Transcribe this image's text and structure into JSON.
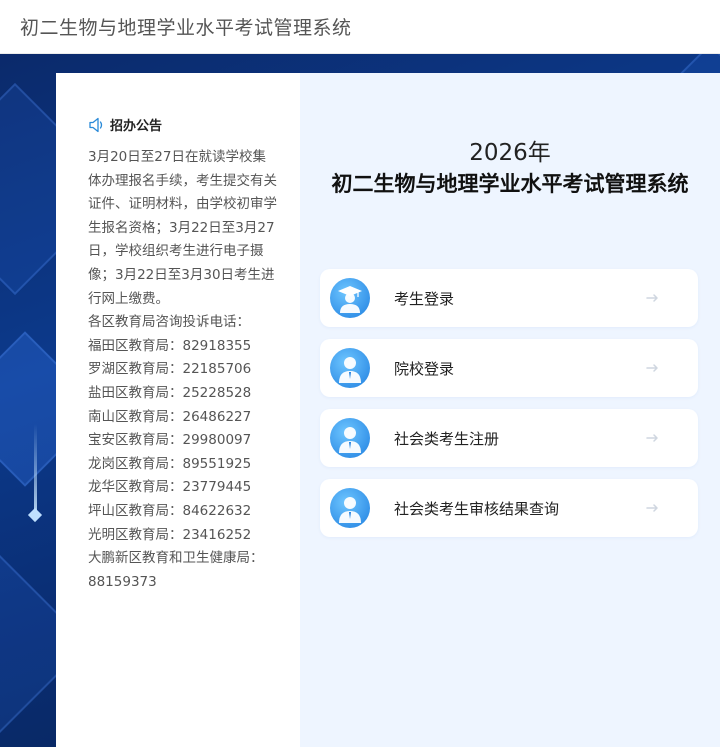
{
  "header": {
    "title": "初二生物与地理学业水平考试管理系统"
  },
  "notice": {
    "heading": "招办公告",
    "paragraphs": [
      "3月20日至27日在就读学校集体办理报名手续，考生提交有关证件、证明材料，由学校初审学生报名资格；3月22日至3月27日，学校组织考生进行电子摄像；3月22日至3月30日考生进行网上缴费。",
      "各区教育局咨询投诉电话：",
      "福田区教育局：82918355",
      "罗湖区教育局：22185706",
      "盐田区教育局：25228528",
      "南山区教育局：26486227",
      "宝安区教育局：29980097",
      "龙岗区教育局：89551925",
      "龙华区教育局：23779445",
      "坪山区教育局：84622632",
      "光明区教育局：23416252",
      "大鹏新区教育和卫生健康局：88159373"
    ]
  },
  "main": {
    "year": "2026年",
    "title": "初二生物与地理学业水平考试管理系统",
    "entries": [
      {
        "label": "考生登录",
        "icon": "graduate-avatar-icon"
      },
      {
        "label": "院校登录",
        "icon": "person-avatar-icon"
      },
      {
        "label": "社会类考生注册",
        "icon": "person-avatar-icon"
      },
      {
        "label": "社会类考生审核结果查询",
        "icon": "person-avatar-icon"
      }
    ]
  },
  "colors": {
    "accent": "#1f7fe0",
    "panel_bg": "#eef5ff",
    "background": "#0c3a8c"
  }
}
